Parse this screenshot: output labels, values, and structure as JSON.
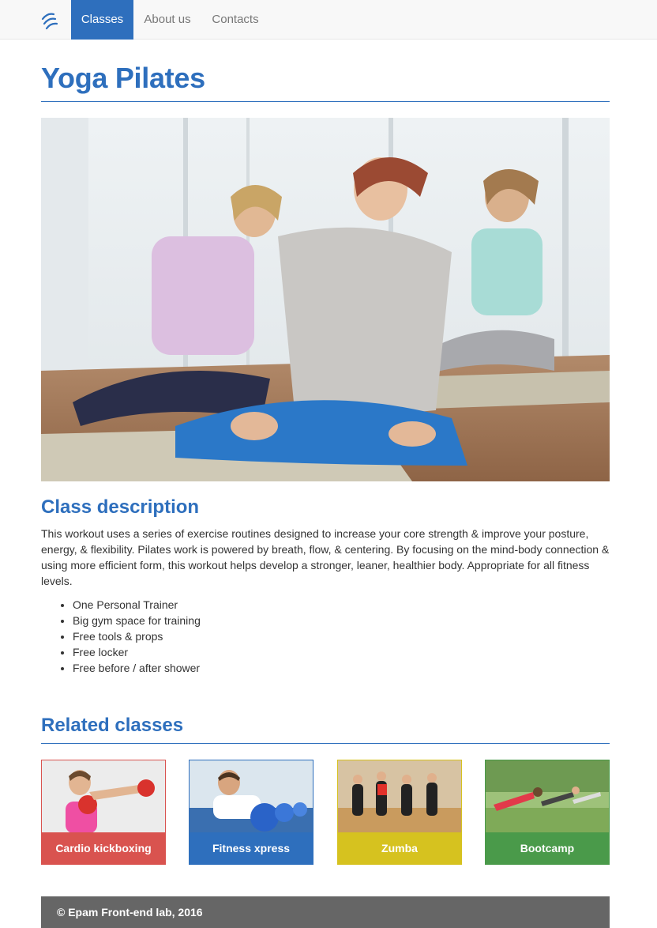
{
  "nav": {
    "logo_icon": "swirl-logo-icon",
    "tabs": [
      {
        "label": "Classes",
        "active": true
      },
      {
        "label": "About us",
        "active": false
      },
      {
        "label": "Contacts",
        "active": false
      }
    ],
    "active_color": "#2e6fbd"
  },
  "page": {
    "title": "Yoga Pilates"
  },
  "description": {
    "heading": "Class description",
    "text": "This workout uses a series of exercise routines designed to increase your core strength & improve your posture, energy, & flexibility. Pilates work is powered by breath, flow, & centering. By focusing on the mind-body connection & using more efficient form, this workout helps develop a stronger, leaner, healthier body. Appropriate for all fitness levels.",
    "features": [
      "One Personal Trainer",
      "Big gym space for training",
      "Free tools & props",
      "Free locker",
      "Free before / after shower"
    ]
  },
  "related": {
    "heading": "Related classes",
    "cards": [
      {
        "label": "Cardio kickboxing",
        "color": "#d9534f"
      },
      {
        "label": "Fitness xpress",
        "color": "#2e6fbd"
      },
      {
        "label": "Zumba",
        "color": "#d6c21f"
      },
      {
        "label": "Bootcamp",
        "color": "#4a9a4a"
      }
    ]
  },
  "footer": {
    "text": "© Epam Front-end lab, 2016"
  }
}
